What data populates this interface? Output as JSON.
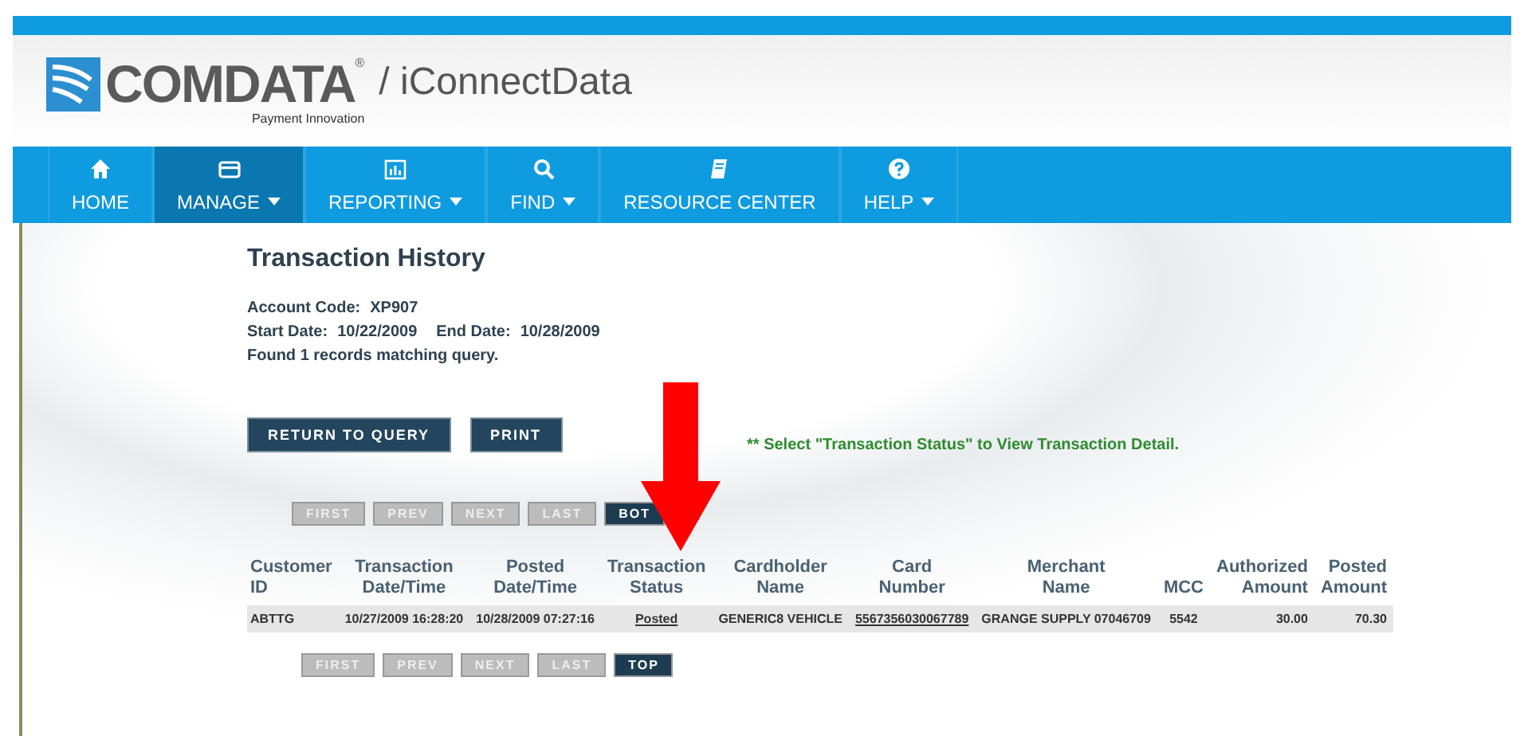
{
  "header": {
    "brand": "COMDATA",
    "trademark": "®",
    "tagline": "Payment Innovation",
    "product": "/ iConnectData"
  },
  "nav": [
    {
      "label": "HOME",
      "has_menu": false,
      "selected": false
    },
    {
      "label": "MANAGE",
      "has_menu": true,
      "selected": true
    },
    {
      "label": "REPORTING",
      "has_menu": true,
      "selected": false
    },
    {
      "label": "FIND",
      "has_menu": true,
      "selected": false
    },
    {
      "label": "RESOURCE CENTER",
      "has_menu": false,
      "selected": false
    },
    {
      "label": "HELP",
      "has_menu": true,
      "selected": false
    }
  ],
  "page": {
    "title": "Transaction History",
    "account_label": "Account Code:",
    "account_code": "XP907",
    "start_label": "Start Date:",
    "start_date": "10/22/2009",
    "end_label": "End Date:",
    "end_date": "10/28/2009",
    "result": "Found 1 records matching query."
  },
  "actions": [
    "RETURN TO QUERY",
    "PRINT"
  ],
  "hint": "** Select \"Transaction Status\" to View Transaction Detail.",
  "pager_top": [
    {
      "label": "FIRST",
      "disabled": true
    },
    {
      "label": "PREV",
      "disabled": true
    },
    {
      "label": "NEXT",
      "disabled": true
    },
    {
      "label": "LAST",
      "disabled": true
    },
    {
      "label": "BOT",
      "disabled": false
    }
  ],
  "table": {
    "columns": [
      {
        "label": "Customer ID"
      },
      {
        "label": "Transaction Date/Time"
      },
      {
        "label": "Posted Date/Time"
      },
      {
        "label": "Transaction Status"
      },
      {
        "label": "Cardholder Name"
      },
      {
        "label": "Card Number"
      },
      {
        "label": "Merchant Name"
      },
      {
        "label": "MCC"
      },
      {
        "label": "Authorized Amount"
      },
      {
        "label": "Posted Amount"
      }
    ],
    "rows": [
      {
        "cells": [
          {
            "text": "ABTTG",
            "kind": "text"
          },
          {
            "text": "10/27/2009 16:28:20",
            "kind": "text"
          },
          {
            "text": "10/28/2009 07:27:16",
            "kind": "text"
          },
          {
            "text": "Posted",
            "kind": "link"
          },
          {
            "text": "GENERIC8 VEHICLE",
            "kind": "text"
          },
          {
            "text": "5567356030067789",
            "kind": "link"
          },
          {
            "text": "GRANGE SUPPLY 07046709",
            "kind": "text"
          },
          {
            "text": "5542",
            "kind": "text"
          },
          {
            "text": "30.00",
            "kind": "number"
          },
          {
            "text": "70.30",
            "kind": "number"
          }
        ]
      }
    ]
  },
  "pager_bottom": [
    {
      "label": "FIRST",
      "disabled": true
    },
    {
      "label": "PREV",
      "disabled": true
    },
    {
      "label": "NEXT",
      "disabled": true
    },
    {
      "label": "LAST",
      "disabled": true
    },
    {
      "label": "TOP",
      "disabled": false
    }
  ]
}
